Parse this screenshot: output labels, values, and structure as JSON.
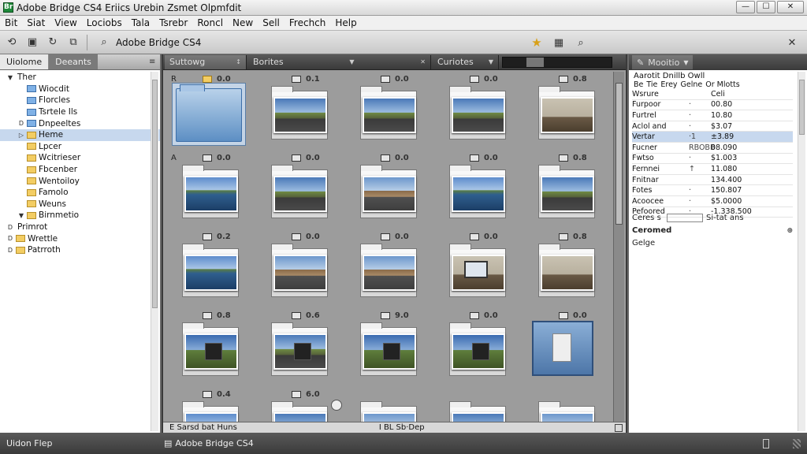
{
  "window": {
    "title": "Adobe Bridge CS4  Eriics  Urebin Zsmet Olpmfdit",
    "app_icon_letter": "Br",
    "controls": {
      "minimize": "—",
      "maximize": "☐",
      "close": "✕"
    }
  },
  "menubar": [
    "Bit",
    "Siat",
    "View",
    "Lociobs",
    "Tala",
    "Tsrebr",
    "Roncl",
    "New",
    "Sell",
    "Frechch",
    "Help"
  ],
  "toolbar": {
    "path_label": "Adobe Bridge CS4",
    "icons": [
      "reload-icon",
      "save-icon",
      "refresh-icon",
      "copy-icon",
      "search-icon"
    ],
    "right_icons": [
      "star-icon",
      "grid-icon",
      "search-icon"
    ],
    "right_glyph": "✕"
  },
  "left_panel": {
    "tabs": [
      {
        "label": "Uiolome",
        "active": true
      },
      {
        "label": "Deeants",
        "active": false
      }
    ],
    "tree": [
      {
        "label": "Ther",
        "indent": 0,
        "toggle": "▼",
        "icon": "none",
        "selected": false
      },
      {
        "label": "Wiocdit",
        "indent": 1,
        "toggle": "",
        "icon": "blue",
        "selected": false
      },
      {
        "label": "Florcles",
        "indent": 1,
        "toggle": "",
        "icon": "blue",
        "selected": false
      },
      {
        "label": "Tsrtele Ils",
        "indent": 1,
        "toggle": "",
        "icon": "blue",
        "selected": false
      },
      {
        "label": "Dnpeeltes",
        "indent": 1,
        "toggle": "D",
        "icon": "blue",
        "selected": false
      },
      {
        "label": "Heme",
        "indent": 1,
        "toggle": "▷",
        "icon": "yellow",
        "selected": true
      },
      {
        "label": "Lpcer",
        "indent": 1,
        "toggle": "",
        "icon": "yellow",
        "selected": false
      },
      {
        "label": "Wcitrieser",
        "indent": 1,
        "toggle": "",
        "icon": "yellow",
        "selected": false
      },
      {
        "label": "Fbcenber",
        "indent": 1,
        "toggle": "",
        "icon": "yellow",
        "selected": false
      },
      {
        "label": "Wentoiloy",
        "indent": 1,
        "toggle": "",
        "icon": "yellow",
        "selected": false
      },
      {
        "label": "Famolo",
        "indent": 1,
        "toggle": "",
        "icon": "yellow",
        "selected": false
      },
      {
        "label": "Weuns",
        "indent": 1,
        "toggle": "",
        "icon": "yellow",
        "selected": false
      },
      {
        "label": "Birnmetio",
        "indent": 1,
        "toggle": "▼",
        "icon": "yellow",
        "selected": false
      },
      {
        "label": "Primrot",
        "indent": 0,
        "toggle": "D",
        "icon": "none",
        "selected": false
      },
      {
        "label": "Wrettle",
        "indent": 0,
        "toggle": "D",
        "icon": "yellow",
        "selected": false
      },
      {
        "label": "Patrroth",
        "indent": 0,
        "toggle": "D",
        "icon": "yellow",
        "selected": false
      }
    ]
  },
  "content": {
    "tabs": [
      {
        "label": "Suttowg",
        "extra": "↕"
      },
      {
        "label": "Borites",
        "extra": "✕"
      },
      {
        "label": "Curiotes",
        "extra": ""
      }
    ],
    "rows": [
      [
        {
          "letter": "R",
          "val": "0.0",
          "icon": "yellow",
          "kind": "folder-selected"
        },
        {
          "letter": "",
          "val": "0.1",
          "icon": "plain",
          "kind": "photo-road"
        },
        {
          "letter": "",
          "val": "0.0",
          "icon": "plain",
          "kind": "photo-road"
        },
        {
          "letter": "",
          "val": "0.0",
          "icon": "plain",
          "kind": "photo-road"
        },
        {
          "letter": "",
          "val": "0.8",
          "icon": "plain",
          "kind": "photo-room"
        }
      ],
      [
        {
          "letter": "A",
          "val": "0.0",
          "icon": "plain",
          "kind": "photo-water"
        },
        {
          "letter": "",
          "val": "0.0",
          "icon": "plain",
          "kind": "photo-road"
        },
        {
          "letter": "",
          "val": "0.0",
          "icon": "plain",
          "kind": "photo-street"
        },
        {
          "letter": "",
          "val": "0.0",
          "icon": "plain",
          "kind": "photo-water"
        },
        {
          "letter": "",
          "val": "0.8",
          "icon": "plain",
          "kind": "photo-road"
        }
      ],
      [
        {
          "letter": "",
          "val": "0.2",
          "icon": "plain",
          "kind": "photo-water"
        },
        {
          "letter": "",
          "val": "0.0",
          "icon": "plain",
          "kind": "photo-street"
        },
        {
          "letter": "",
          "val": "0.0",
          "icon": "plain",
          "kind": "photo-street"
        },
        {
          "letter": "",
          "val": "0.0",
          "icon": "plain",
          "kind": "photo-room-screen"
        },
        {
          "letter": "",
          "val": "0.8",
          "icon": "plain",
          "kind": "photo-room"
        }
      ],
      [
        {
          "letter": "",
          "val": "0.8",
          "icon": "plain",
          "kind": "photo-monitor-device"
        },
        {
          "letter": "",
          "val": "0.6",
          "icon": "plain",
          "kind": "photo-road-device"
        },
        {
          "letter": "",
          "val": "9.0",
          "icon": "plain",
          "kind": "photo-monitor-device"
        },
        {
          "letter": "",
          "val": "0.0",
          "icon": "plain",
          "kind": "photo-monitor-device"
        },
        {
          "letter": "",
          "val": "0.0",
          "icon": "plain",
          "kind": "blue-card"
        }
      ],
      [
        {
          "letter": "",
          "val": "0.4",
          "icon": "plain",
          "kind": "photo-water"
        },
        {
          "letter": "",
          "val": "6.0",
          "icon": "plain",
          "kind": "photo-road"
        },
        {
          "letter": "",
          "val": "",
          "icon": "none",
          "kind": "photo-street"
        },
        {
          "letter": "",
          "val": "",
          "icon": "none",
          "kind": "photo-road"
        },
        {
          "letter": "",
          "val": "",
          "icon": "none",
          "kind": "photo-street"
        }
      ]
    ],
    "status_left": "E  Sarsd bat   Huns",
    "status_mid": "I  BL Sb·Dep"
  },
  "right_panel": {
    "tab_label": "Mooitio",
    "header_line1": "Aarotit Dnillb Owll",
    "header_line2": [
      "Be",
      "Tie",
      "Erey",
      "Gelne",
      "Or Mlotts"
    ],
    "rows": [
      {
        "key": "Wsrure",
        "mark": "",
        "value": "Celi",
        "selected": false
      },
      {
        "key": "Furpoor",
        "mark": "·",
        "value": "00.80",
        "selected": false
      },
      {
        "key": "Furtrel",
        "mark": "·",
        "value": "10.80",
        "selected": false
      },
      {
        "key": "Aclol and",
        "mark": "·",
        "value": "$3.07",
        "selected": false
      },
      {
        "key": "Vertar",
        "mark": "·1",
        "value": "±3.89",
        "selected": true
      },
      {
        "key": "Fucner",
        "mark": "RBOBB",
        "value": "08.090",
        "selected": false
      },
      {
        "key": "Fwtso",
        "mark": "·",
        "value": "$1.003",
        "selected": false
      },
      {
        "key": "Fernnei",
        "mark": "↑",
        "value": "11.080",
        "selected": false
      },
      {
        "key": "Fnitnar",
        "mark": "",
        "value": "134.400",
        "selected": false
      },
      {
        "key": "Fotes",
        "mark": "·",
        "value": "150.807",
        "selected": false
      },
      {
        "key": "Acoocee",
        "mark": "·",
        "value": "$5.0000",
        "selected": false
      },
      {
        "key": "Pefoored",
        "mark": "·",
        "value": "-1.338.500",
        "selected": false
      }
    ],
    "input_row": {
      "key": "Ceres s",
      "value": "Si-tat ans"
    },
    "section1": "Ceromed",
    "section1_icon": "⊕",
    "section2": "Gelge"
  },
  "statusbar": {
    "left": "Uidon Flep",
    "mid": "Adobe Bridge CS4"
  }
}
